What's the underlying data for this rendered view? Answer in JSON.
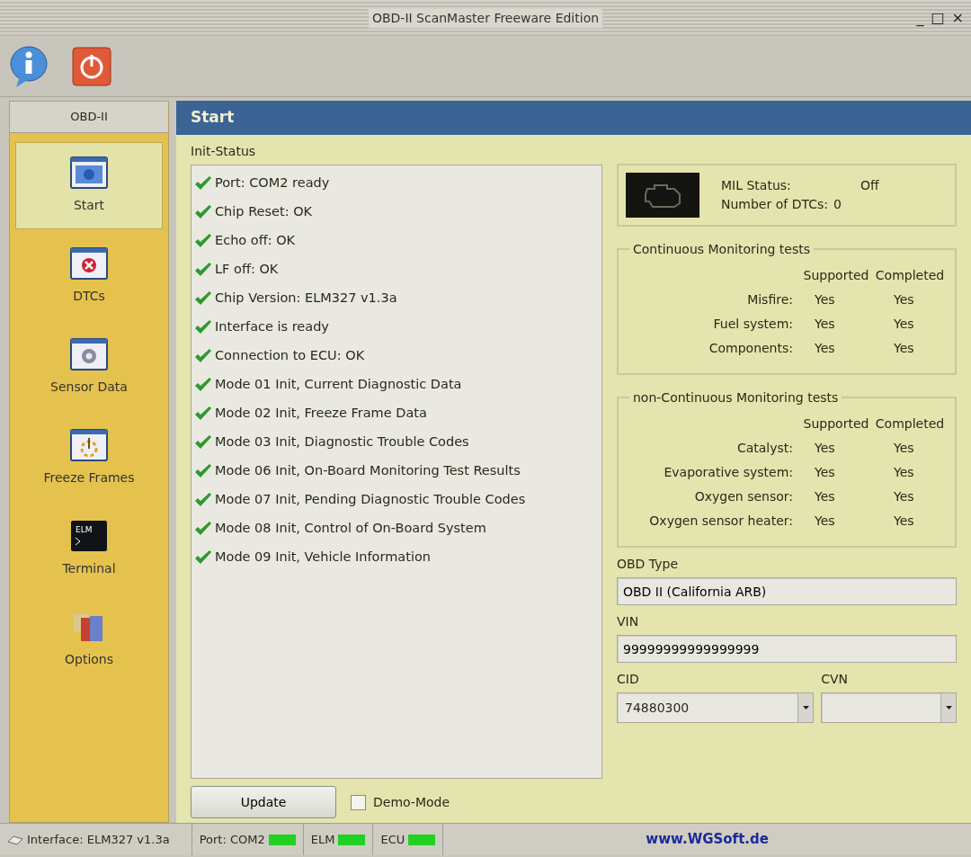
{
  "window": {
    "title": "OBD-II ScanMaster Freeware Edition",
    "controls": [
      "_",
      "□",
      "×"
    ]
  },
  "sidebar": {
    "header": "OBD-II",
    "items": [
      {
        "label": "Start",
        "kind": "start",
        "selected": true
      },
      {
        "label": "DTCs",
        "kind": "dtc",
        "selected": false
      },
      {
        "label": "Sensor Data",
        "kind": "sensor",
        "selected": false
      },
      {
        "label": "Freeze Frames",
        "kind": "freeze",
        "selected": false
      },
      {
        "label": "Terminal",
        "kind": "terminal",
        "icon_text": "ELM",
        "selected": false
      },
      {
        "label": "Options",
        "kind": "options",
        "selected": false
      }
    ]
  },
  "panel": {
    "title": "Start",
    "init_status_label": "Init-Status",
    "init_status": [
      {
        "text": "Port: COM2 ready",
        "ok": true
      },
      {
        "text": "Chip Reset: OK",
        "ok": true
      },
      {
        "text": "Echo off: OK",
        "ok": true
      },
      {
        "text": "LF off: OK",
        "ok": true
      },
      {
        "text": "Chip Version: ELM327 v1.3a",
        "ok": true
      },
      {
        "text": "Interface is ready",
        "ok": true
      },
      {
        "text": "Connection to ECU: OK",
        "ok": true
      },
      {
        "text": "Mode 01 Init, Current Diagnostic Data",
        "ok": true
      },
      {
        "text": "Mode 02 Init, Freeze Frame Data",
        "ok": true
      },
      {
        "text": "Mode 03 Init, Diagnostic Trouble Codes",
        "ok": true
      },
      {
        "text": "Mode 06 Init, On-Board Monitoring Test Results",
        "ok": true
      },
      {
        "text": "Mode 07 Init, Pending Diagnostic Trouble Codes",
        "ok": true
      },
      {
        "text": "Mode 08 Init, Control of On-Board System",
        "ok": true
      },
      {
        "text": "Mode 09 Init, Vehicle Information",
        "ok": true
      }
    ],
    "mil": {
      "status_label": "MIL Status:",
      "status": "Off",
      "dtc_label": "Number of DTCs:",
      "dtc_count": "0",
      "lit": false
    },
    "monitor_groups": [
      {
        "title": "Continuous Monitoring tests",
        "columns": [
          "Supported",
          "Completed"
        ],
        "rows": [
          {
            "name": "Misfire:",
            "supported": "Yes",
            "completed": "Yes"
          },
          {
            "name": "Fuel system:",
            "supported": "Yes",
            "completed": "Yes"
          },
          {
            "name": "Components:",
            "supported": "Yes",
            "completed": "Yes"
          }
        ]
      },
      {
        "title": "non-Continuous Monitoring tests",
        "columns": [
          "Supported",
          "Completed"
        ],
        "rows": [
          {
            "name": "Catalyst:",
            "supported": "Yes",
            "completed": "Yes"
          },
          {
            "name": "Evaporative system:",
            "supported": "Yes",
            "completed": "Yes"
          },
          {
            "name": "Oxygen sensor:",
            "supported": "Yes",
            "completed": "Yes"
          },
          {
            "name": "Oxygen sensor heater:",
            "supported": "Yes",
            "completed": "Yes"
          }
        ]
      }
    ],
    "obd_type": {
      "label": "OBD Type",
      "value": "OBD II (California ARB)"
    },
    "vin": {
      "label": "VIN",
      "value": "99999999999999999"
    },
    "cid": {
      "label": "CID",
      "value": "74880300"
    },
    "cvn": {
      "label": "CVN"
    },
    "update_button": "Update",
    "demo_mode": {
      "label": "Demo-Mode",
      "checked": false
    }
  },
  "status_bar": {
    "interface": "Interface: ELM327 v1.3a",
    "leds": [
      {
        "label": "Port: COM2",
        "on": true
      },
      {
        "label": "ELM",
        "on": true
      },
      {
        "label": "ECU",
        "on": true
      }
    ],
    "link": "www.WGSoft.de"
  }
}
